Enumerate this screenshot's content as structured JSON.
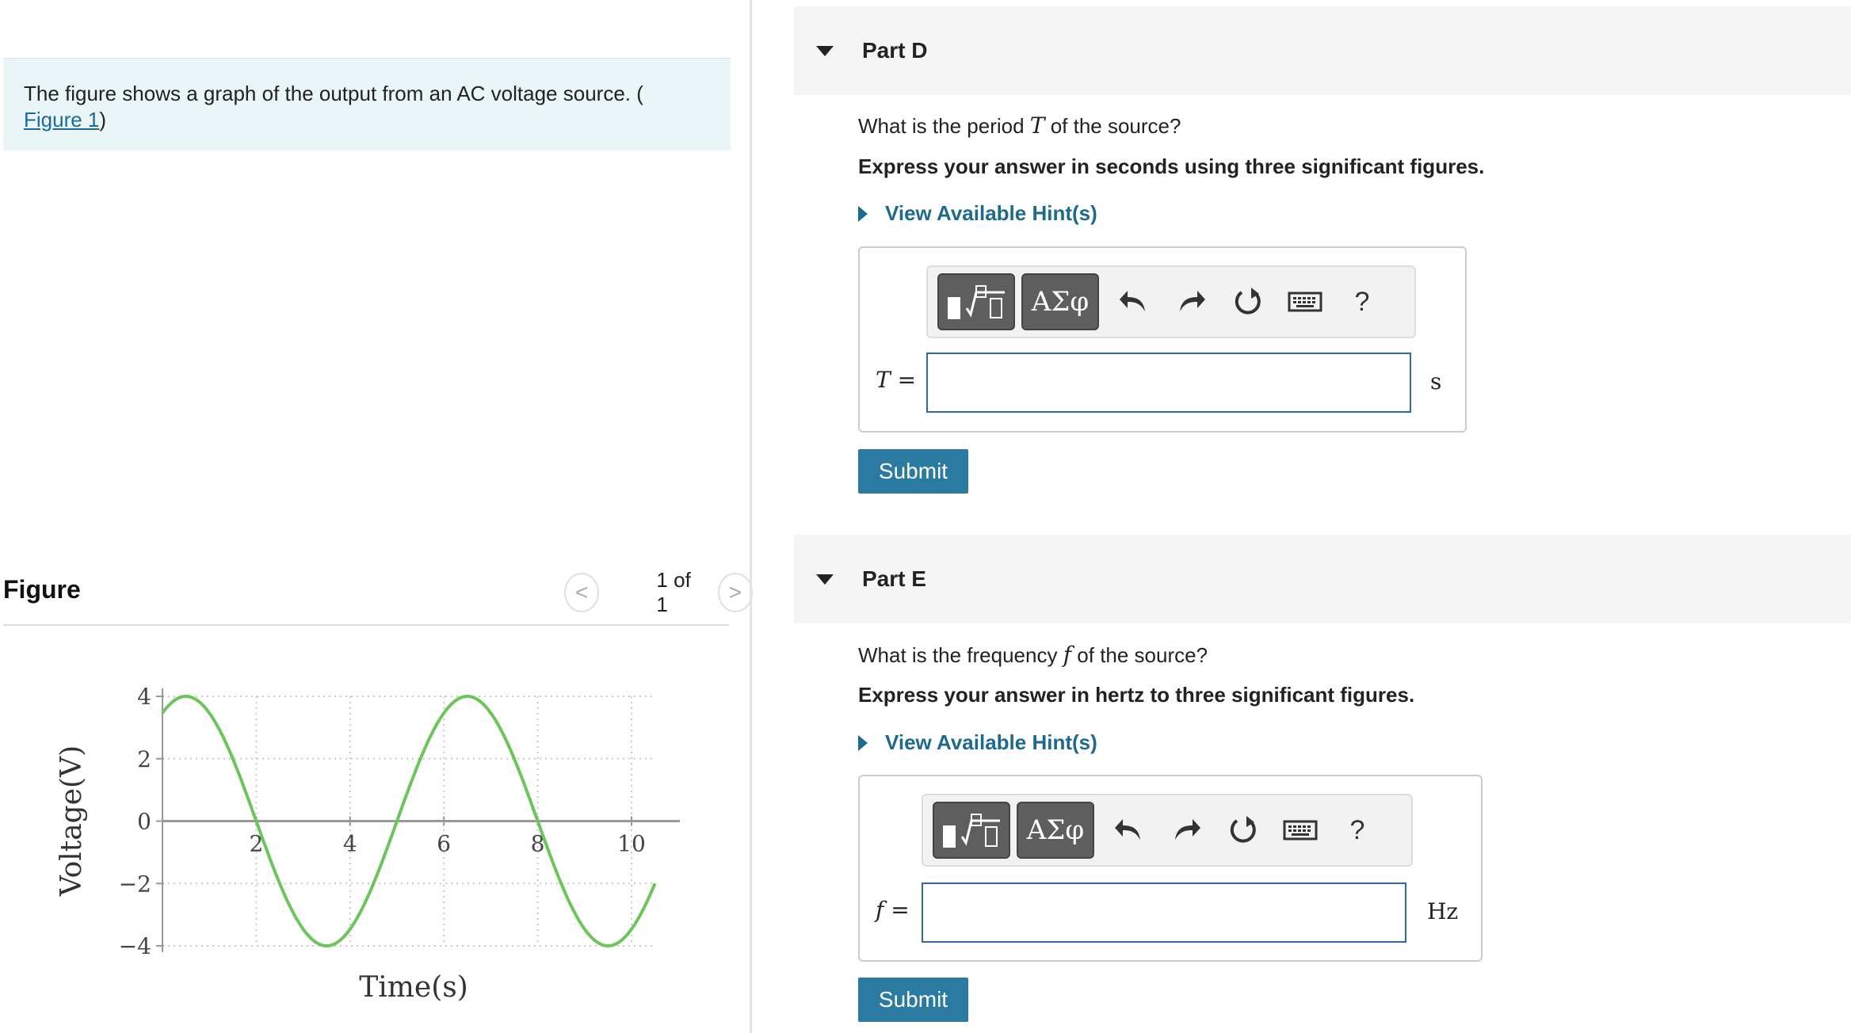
{
  "intro": {
    "text": "The figure shows a graph of the output from an AC voltage source. (",
    "link": "Figure 1",
    "close": ")"
  },
  "figure": {
    "title": "Figure",
    "pager": "1 of 1",
    "prev_glyph": "<",
    "next_glyph": ">"
  },
  "chart_data": {
    "type": "line",
    "title": "",
    "xlabel": "Time(s)",
    "ylabel": "Voltage(V)",
    "xlim": [
      0,
      11
    ],
    "ylim": [
      -4,
      4
    ],
    "x_ticks": [
      2,
      4,
      6,
      8,
      10
    ],
    "y_ticks": [
      4,
      2,
      0,
      -2,
      -4
    ],
    "x_tick_labels": [
      "2",
      "4",
      "6",
      "8",
      "10"
    ],
    "y_tick_labels": [
      "4",
      "2",
      "0",
      "−2",
      "−4"
    ],
    "grid": true,
    "grid_style": "dotted",
    "line_color": "#6cc55a",
    "series": [
      {
        "amplitude": 4,
        "period": 6,
        "phase_offset": 2,
        "x": [
          0,
          0.5,
          1,
          1.5,
          2,
          2.5,
          3,
          3.5,
          4,
          4.5,
          5,
          5.5,
          6,
          6.5,
          7,
          7.5,
          8,
          8.5,
          9,
          9.5,
          10,
          10.5
        ],
        "y": [
          3.46,
          4.0,
          3.46,
          2.0,
          0,
          -2.0,
          -3.46,
          -4.0,
          -3.46,
          -2.0,
          0,
          2.0,
          3.46,
          4.0,
          3.46,
          2.0,
          0,
          -2.0,
          -3.46,
          -4.0,
          -3.46,
          -2.0
        ]
      }
    ]
  },
  "partD": {
    "title": "Part D",
    "q_pre": "What is the period ",
    "q_var": "T",
    "q_post": " of the source?",
    "instruction": "Express your answer in seconds using three significant figures.",
    "hint": "View Available Hint(s)",
    "label_var": "T",
    "label_eq": " =",
    "value": "",
    "unit": "s",
    "submit": "Submit"
  },
  "partE": {
    "title": "Part E",
    "q_pre": "What is the frequency ",
    "q_var": "f",
    "q_post": " of the source?",
    "instruction": "Express your answer in hertz to three significant figures.",
    "hint": "View Available Hint(s)",
    "label_var": "f",
    "label_eq": " =",
    "value": "",
    "unit": "Hz",
    "submit": "Submit"
  },
  "toolbar": {
    "greek": "ΑΣφ",
    "help": "?"
  },
  "colors": {
    "accent": "#2a7aa2",
    "link": "#1e6a8d",
    "input_border": "#2b6aa0",
    "intro_bg": "#e9f5f7",
    "curve": "#6cc55a"
  }
}
